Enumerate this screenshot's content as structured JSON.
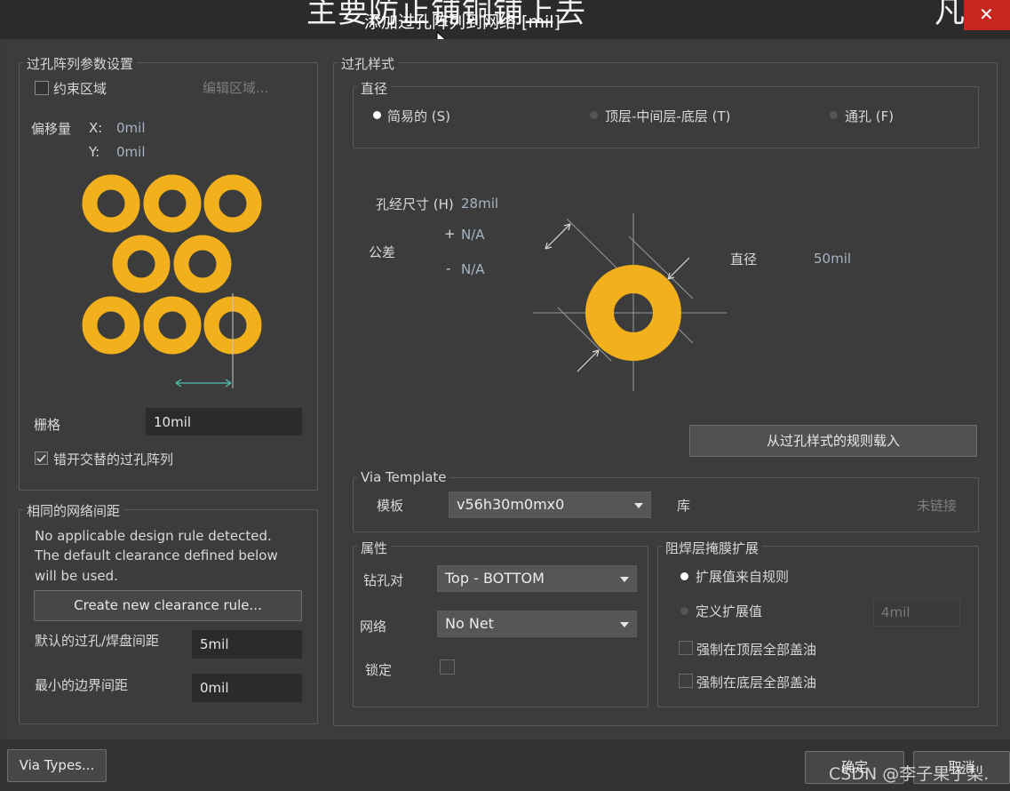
{
  "window": {
    "bg_title": "主要防止铺铜铺上去",
    "bg_title_right": "凡亿",
    "dialog_title": "添加过孔阵列到网络 [mil]"
  },
  "left": {
    "array_group_title": "过孔阵列参数设置",
    "constrain_area_label": "约束区域",
    "edit_area_button": "编辑区域...",
    "offset_label": "偏移量",
    "offset_x_label": "X:",
    "offset_x_value": "0mil",
    "offset_y_label": "Y:",
    "offset_y_value": "0mil",
    "grid_label": "栅格",
    "grid_value": "10mil",
    "stagger_label": "错开交替的过孔阵列",
    "stagger_checked": true,
    "clearance_group_title": "相同的网络间距",
    "clearance_message": [
      "No applicable design rule detected.",
      "The default clearance defined below",
      "will be used."
    ],
    "create_rule_button": "Create new clearance rule...",
    "default_clearance_label": "默认的过孔/焊盘间距",
    "default_clearance_value": "5mil",
    "min_edge_label": "最小的边界间距",
    "min_edge_value": "0mil"
  },
  "right": {
    "style_group_title": "过孔样式",
    "diameter_group_title": "直径",
    "radio_simple": "简易的 (S)",
    "radio_top_mid_bottom": "顶层-中间层-底层 (T)",
    "radio_full": "通孔 (F)",
    "hole_size_label": "孔经尺寸 (H)",
    "hole_size_value": "28mil",
    "tolerance_label": "公差",
    "tolerance_plus_sign": "+",
    "tolerance_plus_value": "N/A",
    "tolerance_minus_sign": "-",
    "tolerance_minus_value": "N/A",
    "diameter_label": "直径",
    "diameter_value": "50mil",
    "load_rule_button": "从过孔样式的规则载入",
    "via_template_title": "Via Template",
    "template_label": "模板",
    "template_value": "v56h30m0mx0",
    "library_label": "库",
    "library_value": "未链接",
    "props_group_title": "属性",
    "drill_pair_label": "钻孔对",
    "drill_pair_value": "Top - BOTTOM",
    "net_label": "网络",
    "net_value": "No Net",
    "lock_label": "锁定",
    "mask_group_title": "阻焊层掩膜扩展",
    "mask_from_rule": "扩展值来自规则",
    "mask_custom": "定义扩展值",
    "mask_custom_value": "4mil",
    "force_top": "强制在顶层全部盖油",
    "force_bottom": "强制在底层全部盖油"
  },
  "footer": {
    "via_types_button": "Via Types...",
    "ok_button": "确定",
    "cancel_button": "取消",
    "watermark": "CSDN @李子果子梨."
  },
  "colors": {
    "via_copper": "#f2b11c",
    "dialog_bg": "#3c3c3c",
    "title_red": "#c8261e"
  }
}
